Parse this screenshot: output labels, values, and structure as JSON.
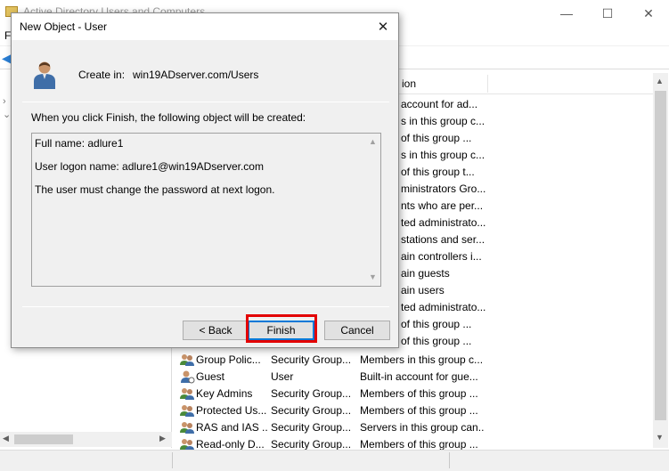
{
  "background_window": {
    "title": "Active Directory Users and Computers",
    "menu_first": "F",
    "column_header_fragment": "ion",
    "partial_rows": [
      "account for ad...",
      "s in this group c...",
      "of this group ...",
      "s in this group c...",
      "of this group t...",
      "ministrators Gro...",
      "nts who are per...",
      "ted administrato...",
      "stations and ser...",
      "ain controllers i...",
      "ain guests",
      "ain users",
      "ted administrato...",
      "of this group ...",
      "of this group ..."
    ],
    "rows": [
      {
        "name": "Group Polic...",
        "type": "Security Group...",
        "desc": "Members in this group c..."
      },
      {
        "name": "Guest",
        "type": "User",
        "desc": "Built-in account for gue..."
      },
      {
        "name": "Key Admins",
        "type": "Security Group...",
        "desc": "Members of this group ..."
      },
      {
        "name": "Protected Us...",
        "type": "Security Group...",
        "desc": "Members of this group ..."
      },
      {
        "name": "RAS and IAS ...",
        "type": "Security Group...",
        "desc": "Servers in this group can..."
      },
      {
        "name": "Read-only D...",
        "type": "Security Group...",
        "desc": "Members of this group ..."
      }
    ]
  },
  "dialog": {
    "title": "New Object - User",
    "create_in_label": "Create in:",
    "create_in_path": "win19ADserver.com/Users",
    "intro": "When you click Finish, the following object will be created:",
    "summary_lines": [
      "Full name: adlure1",
      "User logon name: adlure1@win19ADserver.com",
      "The user must change the password at next logon."
    ],
    "buttons": {
      "back": "< Back",
      "finish": "Finish",
      "cancel": "Cancel"
    }
  },
  "colors": {
    "highlight": "#e30000",
    "focus_border": "#0078d7",
    "dialog_bg": "#f0f0f0"
  }
}
